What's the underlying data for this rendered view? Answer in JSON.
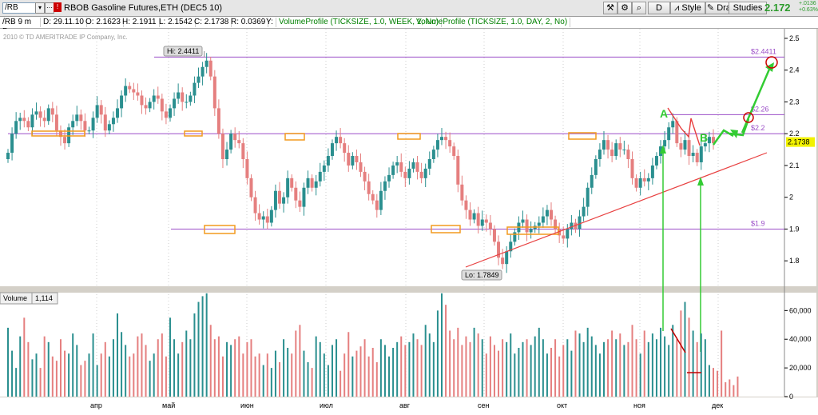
{
  "toolbar": {
    "symbol": "/RB",
    "title": "RBOB Gasoline Futures,ETH (DEC5 10)",
    "period_button": "D",
    "style_button": "Style",
    "drawings_button": "Drawings",
    "studies_button": "Studies",
    "last_price": "2.172",
    "change_1": "+.0136",
    "change_2": "+0.63%"
  },
  "infobar": {
    "period": "/RB 9 m D",
    "date": "D: 29.11.10",
    "open": "O: 2.1623",
    "high": "H: 2.1911",
    "low": "L: 2.1542",
    "close": "C: 2.1738",
    "range": "R: 0.0369",
    "y": "Y:",
    "study1": "VolumeProfile (TICKSIZE, 1.0, WEEK, 1, No)",
    "study2": "VolumeProfile (TICKSIZE, 1.0, DAY, 2, No)"
  },
  "colors": {
    "up": "#2a8f8f",
    "down": "#e57f7f",
    "level": "#9c4fc8",
    "trend": "#e84040",
    "annot": "#33cc33",
    "box": "#f29a1e",
    "last_price_tag": "#f2f200"
  },
  "chart_data": [
    {
      "type": "candlestick",
      "copyright": "2010 © TD AMERITRADE IP Company, Inc.",
      "ylim": [
        1.72,
        2.52
      ],
      "yticks": [
        "2.5",
        "2.4",
        "2.3",
        "2.2",
        "2.1",
        "2",
        "1.9",
        "1.8"
      ],
      "months": [
        "апр",
        "май",
        "июн",
        "июл",
        "авг",
        "сен",
        "окт",
        "ноя",
        "дек"
      ],
      "close": [
        2.14,
        2.2,
        2.24,
        2.25,
        2.24,
        2.22,
        2.26,
        2.27,
        2.25,
        2.24,
        2.28,
        2.26,
        2.21,
        2.19,
        2.17,
        2.22,
        2.24,
        2.26,
        2.24,
        2.21,
        2.21,
        2.25,
        2.29,
        2.26,
        2.21,
        2.23,
        2.25,
        2.28,
        2.32,
        2.35,
        2.34,
        2.33,
        2.32,
        2.29,
        2.28,
        2.3,
        2.32,
        2.31,
        2.27,
        2.25,
        2.28,
        2.31,
        2.33,
        2.3,
        2.3,
        2.32,
        2.36,
        2.38,
        2.41,
        2.43,
        2.38,
        2.28,
        2.2,
        2.12,
        2.15,
        2.2,
        2.18,
        2.17,
        2.12,
        2.06,
        2.0,
        1.95,
        1.93,
        1.94,
        1.92,
        1.96,
        2.02,
        1.98,
        2.0,
        2.06,
        2.03,
        1.99,
        1.97,
        2.03,
        2.06,
        2.03,
        2.05,
        2.08,
        2.1,
        2.13,
        2.17,
        2.19,
        2.17,
        2.14,
        2.1,
        2.13,
        2.11,
        2.08,
        2.05,
        2.01,
        1.99,
        1.96,
        2.02,
        2.05,
        2.07,
        2.1,
        2.11,
        2.08,
        2.06,
        2.09,
        2.11,
        2.08,
        2.06,
        2.09,
        2.12,
        2.15,
        2.18,
        2.19,
        2.18,
        2.16,
        2.13,
        2.04,
        1.99,
        1.96,
        1.93,
        1.95,
        1.91,
        1.93,
        1.92,
        1.9,
        1.86,
        1.81,
        1.79,
        1.83,
        1.86,
        1.89,
        1.92,
        1.93,
        1.89,
        1.9,
        1.91,
        1.92,
        1.94,
        1.96,
        1.93,
        1.9,
        1.88,
        1.87,
        1.9,
        1.92,
        1.9,
        1.94,
        1.97,
        2.03,
        2.07,
        2.12,
        2.15,
        2.18,
        2.15,
        2.13,
        2.17,
        2.15,
        2.15,
        2.12,
        2.06,
        2.03,
        2.06,
        2.05,
        2.06,
        2.1,
        2.13,
        2.16,
        2.18,
        2.22,
        2.24,
        2.17,
        2.15,
        2.18,
        2.13,
        2.14,
        2.11,
        2.16,
        2.17,
        2.19,
        2.17
      ],
      "annotations": [
        "Hi: 2.4411",
        "Lo: 1.7849"
      ],
      "levels": [
        {
          "label": "$2.4411",
          "value": 2.4411
        },
        {
          "label": "$2.26",
          "value": 2.26
        },
        {
          "label": "$2.2",
          "value": 2.2
        },
        {
          "label": "$1.9",
          "value": 1.9
        }
      ],
      "last_price_tag": "2.1738",
      "wave_labels": [
        "A",
        "B"
      ]
    },
    {
      "type": "bar",
      "title": "Volume",
      "value": "1,114",
      "ylim": [
        0,
        68000
      ],
      "yticks": [
        "60,000",
        "40,000",
        "20,000",
        "0"
      ],
      "values": [
        48,
        32,
        20,
        42,
        55,
        38,
        26,
        30,
        20,
        42,
        38,
        28,
        25,
        40,
        32,
        30,
        44,
        36,
        22,
        25,
        30,
        44,
        22,
        30,
        38,
        28,
        40,
        58,
        45,
        36,
        28,
        30,
        42,
        44,
        36,
        25,
        30,
        40,
        44,
        28,
        55,
        40,
        30,
        38,
        46,
        40,
        58,
        66,
        70,
        72,
        50,
        40,
        42,
        28,
        38,
        36,
        40,
        42,
        30,
        38,
        40,
        28,
        30,
        22,
        30,
        20,
        32,
        24,
        40,
        34,
        30,
        46,
        50,
        32,
        24,
        20,
        42,
        38,
        30,
        22,
        36,
        40,
        18,
        30,
        45,
        28,
        32,
        35,
        40,
        28,
        34,
        24,
        40,
        36,
        28,
        34,
        38,
        42,
        36,
        38,
        44,
        40,
        36,
        50,
        44,
        38,
        60,
        72,
        64,
        46,
        40,
        48,
        36,
        42,
        38,
        48,
        44,
        40,
        30,
        42,
        36,
        32,
        40,
        38,
        44,
        30,
        34,
        38,
        40,
        36,
        42,
        48,
        40,
        30,
        34,
        40,
        28,
        36,
        40,
        32,
        46,
        44,
        38,
        48,
        42,
        36,
        30,
        38,
        40,
        46,
        40,
        44,
        36,
        38,
        50,
        40,
        30,
        46,
        38,
        44,
        40,
        48,
        42,
        36,
        50,
        40,
        60,
        66,
        55,
        46,
        38,
        44,
        40,
        22,
        20,
        18,
        46,
        10,
        12,
        8,
        14
      ]
    }
  ]
}
